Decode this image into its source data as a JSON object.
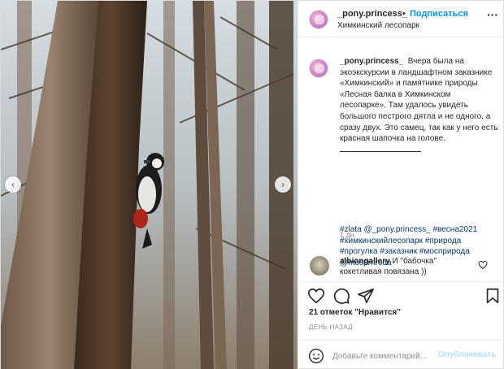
{
  "header": {
    "username": "_pony.princess_",
    "dot": "•",
    "follow_label": "Подписаться",
    "location": "Химкинский лесопарк",
    "more": "···"
  },
  "caption": {
    "username": "_pony.princess_",
    "text": "Вчера была на экоэкскурсии в ландшафтном заказнике «Химкинский» и памятнике природы «Лесная балка в Химкинском лесопарке». Там удалось увидеть большого пестрого дятла и не одного, а сразу двух. Это самец, так как у него есть красная шапочка на голове.",
    "tags_line1": "#zlata @_pony.princess_ #весна2021",
    "tags_line2": "#химкинскийлесопарк #природа",
    "tags_line3": "#прогулка #заказник #мосприрода",
    "tags_line4": "@mosprriroda",
    "time": "1 дн."
  },
  "comment": {
    "username": "albiongallery",
    "text": "И \"бабочка\" кокетливая повязана ))"
  },
  "likes": "21 отметок \"Нравится\"",
  "time_ago": "ДЕНЬ НАЗАД",
  "add_comment": {
    "placeholder": "Добавьте комментарий...",
    "post_label": "Опубликовать"
  },
  "nav": {
    "prev": "‹",
    "next": "›"
  },
  "colors": {
    "link": "#0095f6",
    "hashtag": "#00376b",
    "muted": "#8e8e8e",
    "post_disabled": "#b2dffc"
  }
}
